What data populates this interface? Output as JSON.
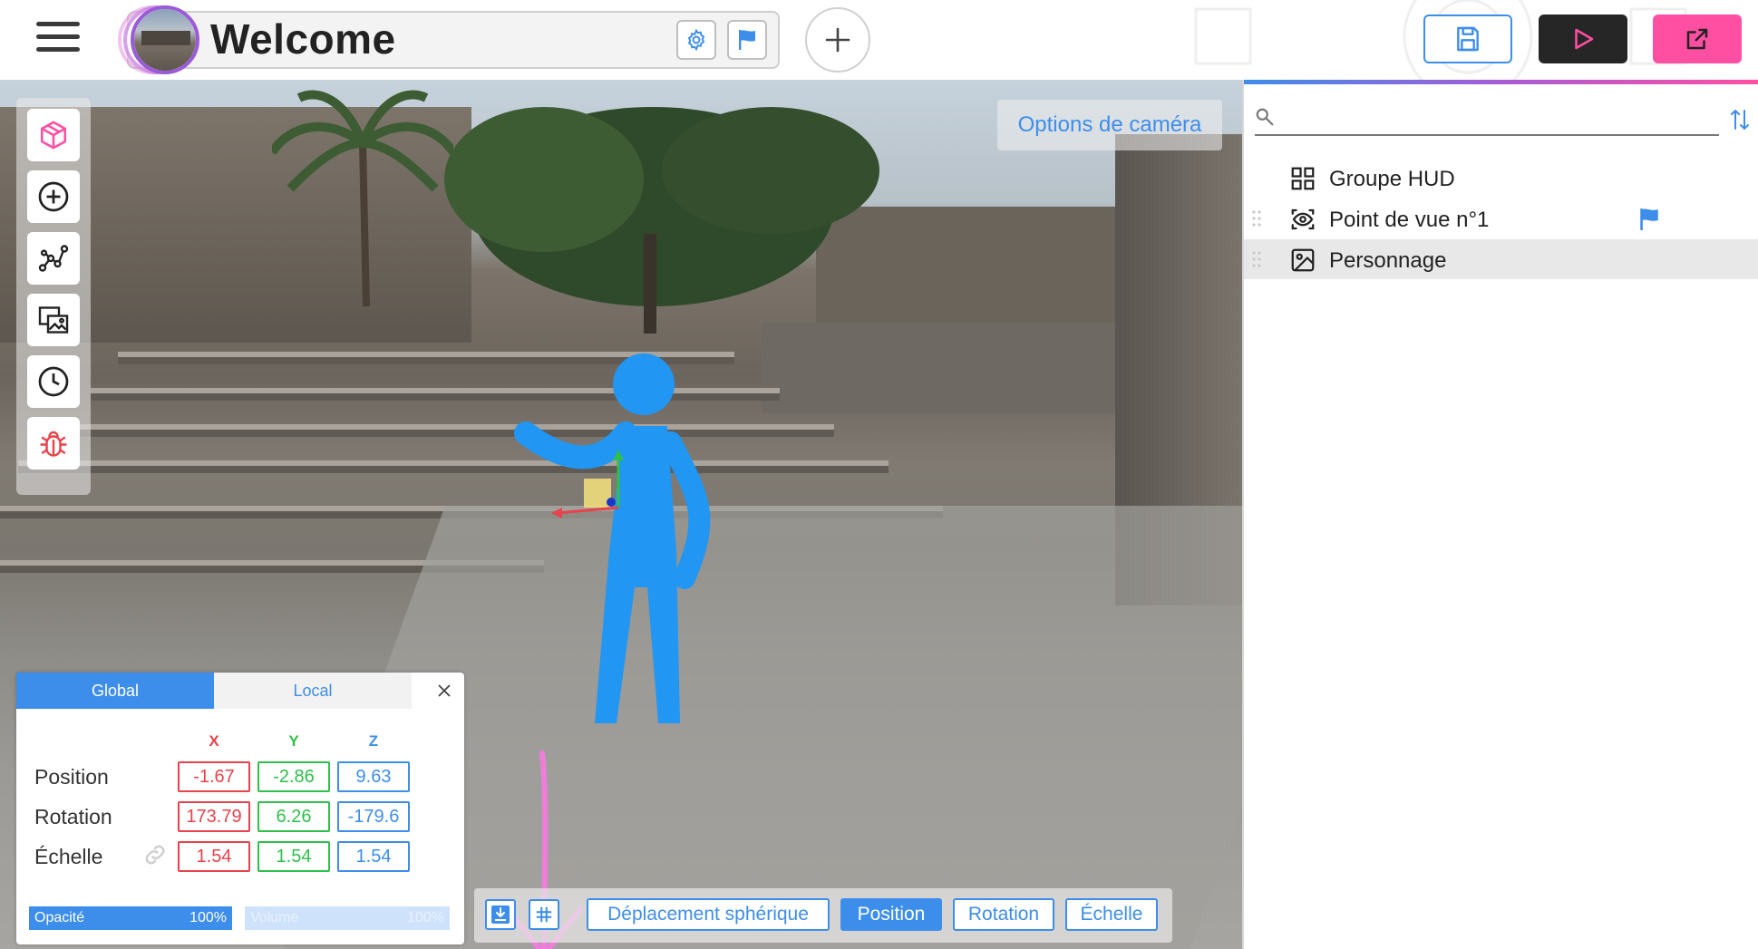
{
  "header": {
    "title": "Welcome",
    "icons": {
      "menu": "hamburger-icon",
      "settings": "gear-icon",
      "flag": "flag-icon",
      "add": "plus-icon",
      "save": "save-icon",
      "play": "play-icon",
      "export": "external-link-icon"
    },
    "colors": {
      "accent": "#3d8eea",
      "play_bg": "#262626",
      "export_bg": "#ff4fa3"
    }
  },
  "viewport": {
    "camera_options_label": "Options de caméra",
    "left_tools": [
      "cube-icon",
      "plus-circle-icon",
      "graph-icon",
      "images-icon",
      "clock-icon",
      "bug-icon"
    ]
  },
  "properties": {
    "tabs": {
      "global": "Global",
      "local": "Local"
    },
    "axes": {
      "x": "X",
      "y": "Y",
      "z": "Z"
    },
    "rows": {
      "position": {
        "label": "Position",
        "x": "-1.67",
        "y": "-2.86",
        "z": "9.63"
      },
      "rotation": {
        "label": "Rotation",
        "x": "173.79",
        "y": "6.26",
        "z": "-179.6"
      },
      "scale": {
        "label": "Échelle",
        "x": "1.54",
        "y": "1.54",
        "z": "1.54"
      }
    },
    "opacity": {
      "label": "Opacité",
      "value": "100%",
      "fraction": 1.0
    },
    "volume": {
      "label": "Volume",
      "value": "100%",
      "fraction": 1.0
    }
  },
  "mode_bar": {
    "buttons": {
      "spherical": "Déplacement sphérique",
      "position": "Position",
      "rotation": "Rotation",
      "scale": "Échelle"
    },
    "active": "position"
  },
  "scene": {
    "search_placeholder": "",
    "items": [
      {
        "label": "Groupe HUD",
        "icon": "grid-icon",
        "selected": false,
        "flag": false
      },
      {
        "label": "Point de vue n°1",
        "icon": "viewpoint-icon",
        "selected": false,
        "flag": true
      },
      {
        "label": "Personnage",
        "icon": "image-icon",
        "selected": true,
        "flag": false
      }
    ]
  }
}
